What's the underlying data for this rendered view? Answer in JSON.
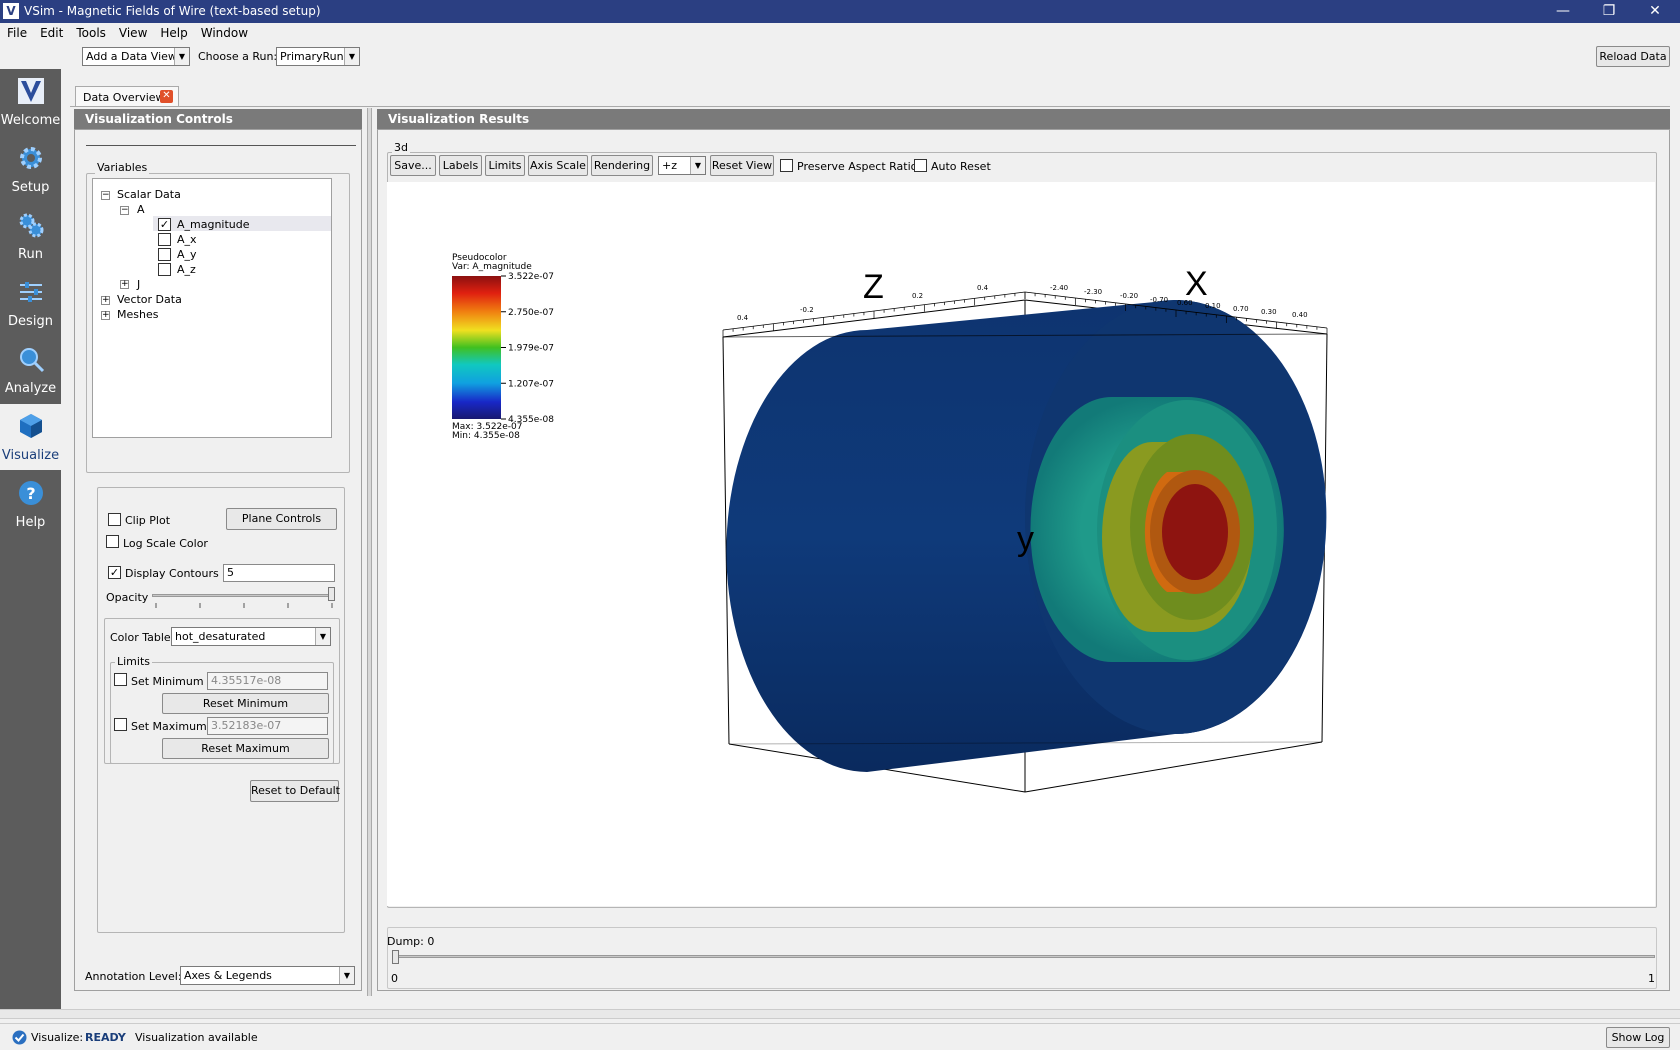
{
  "window": {
    "title": "VSim - Magnetic Fields of Wire (text-based setup)",
    "logo": "V"
  },
  "menu": [
    "File",
    "Edit",
    "Tools",
    "View",
    "Help",
    "Window"
  ],
  "toolbar": {
    "add_data_view": "Add a Data View",
    "choose_run_label": "Choose a Run:",
    "run_value": "PrimaryRun",
    "reload": "Reload Data"
  },
  "sidebar": [
    {
      "label": "Welcome",
      "icon": "vsim-logo-icon"
    },
    {
      "label": "Setup",
      "icon": "gear-icon"
    },
    {
      "label": "Run",
      "icon": "gears-icon"
    },
    {
      "label": "Design",
      "icon": "sliders-icon"
    },
    {
      "label": "Analyze",
      "icon": "magnifier-icon"
    },
    {
      "label": "Visualize",
      "icon": "cube-icon"
    },
    {
      "label": "Help",
      "icon": "help-icon"
    }
  ],
  "tab": {
    "label": "Data Overview",
    "close": "✕"
  },
  "controls": {
    "header": "Visualization Controls",
    "variables_label": "Variables",
    "tree": {
      "scalar": "Scalar Data",
      "a": "A",
      "a_mag": "A_magnitude",
      "a_x": "A_x",
      "a_y": "A_y",
      "a_z": "A_z",
      "j": "J",
      "vector": "Vector Data",
      "meshes": "Meshes"
    },
    "clip_plot": "Clip Plot",
    "plane_controls": "Plane Controls",
    "log_scale": "Log Scale Color",
    "display_contours": "Display Contours",
    "contours_value": "5",
    "opacity": "Opacity",
    "color_table_label": "Color Table",
    "color_table_value": "hot_desaturated",
    "limits_label": "Limits",
    "set_min": "Set Minimum",
    "min_value": "4.35517e-08",
    "reset_min": "Reset Minimum",
    "set_max": "Set Maximum",
    "max_value": "3.52183e-07",
    "reset_max": "Reset Maximum",
    "reset_default": "Reset to Default",
    "annotation_label": "Annotation Level:",
    "annotation_value": "Axes & Legends"
  },
  "results": {
    "header": "Visualization Results",
    "group_label": "3d",
    "buttons": {
      "save": "Save...",
      "labels": "Labels",
      "limits": "Limits",
      "axis_scale": "Axis Scale",
      "rendering": "Rendering",
      "reset_view": "Reset View"
    },
    "view_combo": "+z",
    "preserve_aspect": "Preserve Aspect Ratio",
    "auto_reset": "Auto Reset"
  },
  "legend": {
    "title": "Pseudocolor",
    "var": "Var: A_magnitude",
    "ticks": [
      "3.522e-07",
      "2.750e-07",
      "1.979e-07",
      "1.207e-07",
      "4.355e-08"
    ],
    "max": "Max:  3.522e-07",
    "min": "Min:  4.355e-08"
  },
  "axes": {
    "z": "Z",
    "x": "X",
    "y": "y",
    "z_ticks": [
      "0.4",
      "-0.2",
      "0.2",
      "0.4"
    ],
    "x_ticks": [
      "-2.40",
      "-2.30",
      "-0.20",
      "-0.70",
      "0.60",
      "0.10",
      "0.70",
      "0.30",
      "0.40"
    ]
  },
  "dump": {
    "label": "Dump: 0",
    "min": "0",
    "max": "1",
    "fraction": 0.0
  },
  "status": {
    "prefix": "Visualize:",
    "state": "READY",
    "message": "Visualization available",
    "show_log": "Show Log"
  }
}
